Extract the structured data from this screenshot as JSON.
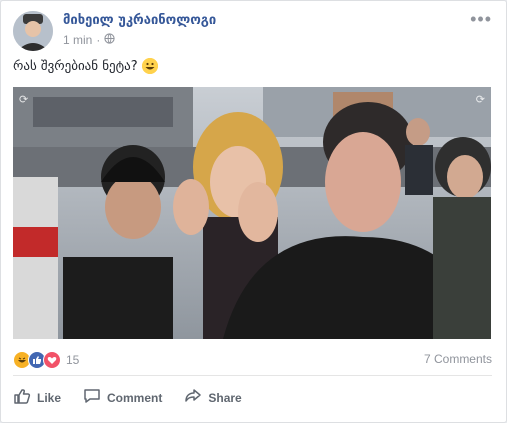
{
  "post": {
    "author": "მიხეილ უკრაინოლოგი",
    "time": "1 min",
    "privacy_icon": "globe-icon",
    "menu_label": "•••",
    "text": "რას შვრებიან ნეტა?",
    "text_emoji_icon": "grinning-face-icon"
  },
  "reactions": {
    "icons": [
      "haha-icon",
      "like-icon",
      "love-icon"
    ],
    "count": "15",
    "comments": "7 Comments"
  },
  "actions": {
    "like": "Like",
    "comment": "Comment",
    "share": "Share"
  },
  "colors": {
    "link": "#365899",
    "meta": "#90949c",
    "like_blue": "#4267b2",
    "love_red": "#f25268",
    "haha_yellow": "#f7b125"
  }
}
